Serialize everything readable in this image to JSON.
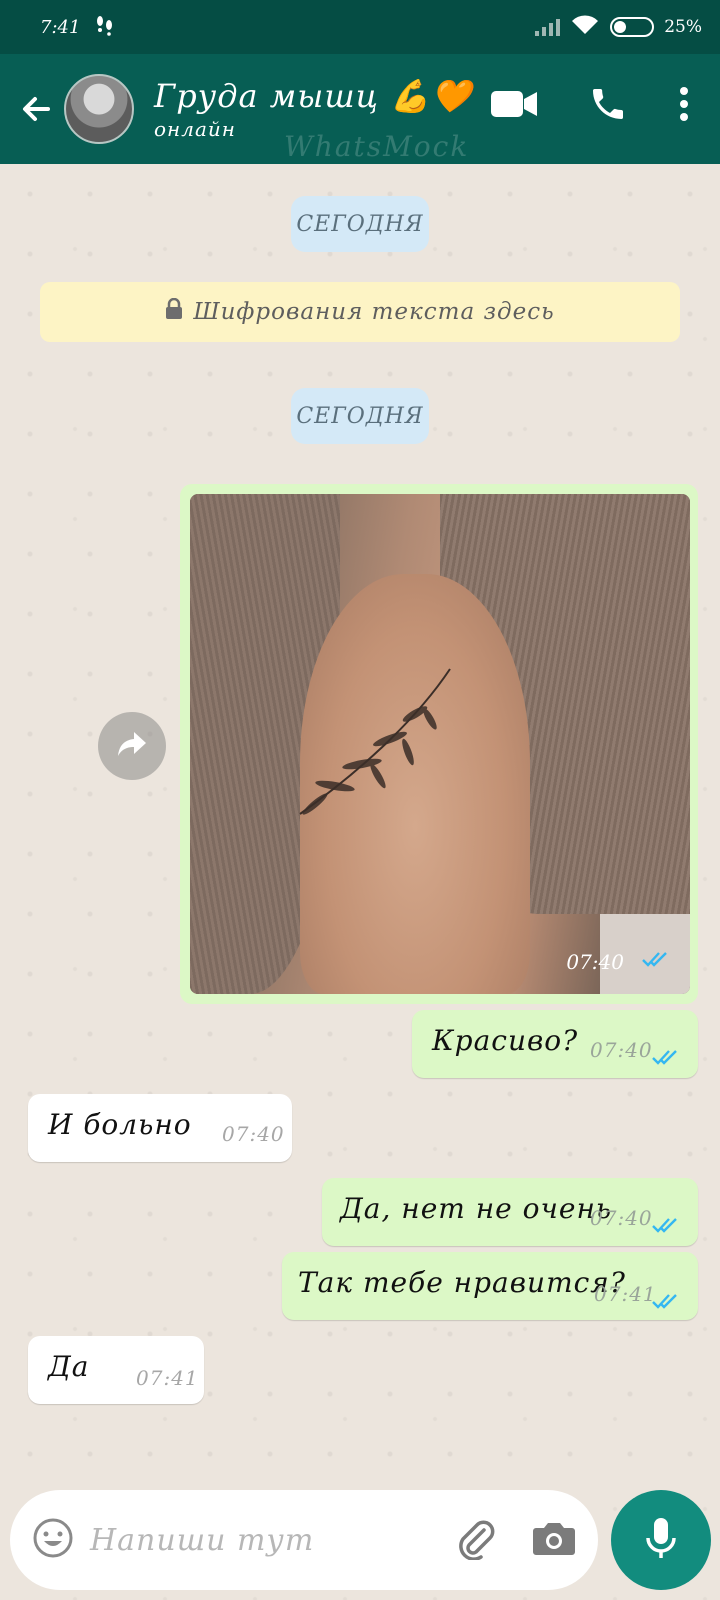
{
  "status_bar": {
    "time": "7:41",
    "battery": "25%"
  },
  "header": {
    "name": "Груда мышц 💪🧡",
    "status": "онлайн",
    "watermark": "WhatsMock"
  },
  "date_chips": [
    "СЕГОДНЯ",
    "СЕГОДНЯ"
  ],
  "encryption_notice": "Шифрования текста здесь",
  "messages": [
    {
      "type": "image",
      "direction": "out",
      "time": "07:40"
    },
    {
      "direction": "out",
      "text": "Красиво?",
      "time": "07:40"
    },
    {
      "direction": "in",
      "text": "И больно",
      "time": "07:40"
    },
    {
      "direction": "out",
      "text": "Да, нет не очень",
      "time": "07:40"
    },
    {
      "direction": "out",
      "text": "Так тебе нравится?",
      "time": "07:41"
    },
    {
      "direction": "in",
      "text": "Да",
      "time": "07:41"
    }
  ],
  "composer": {
    "placeholder": "Напиши тут"
  },
  "colors": {
    "header": "#075e54",
    "status_bar": "#054d44",
    "outgoing": "#dcf8c6",
    "incoming": "#ffffff",
    "read_ticks": "#34b7f1",
    "mic": "#128c7e"
  },
  "icons": [
    "back-arrow-icon",
    "video-call-icon",
    "phone-icon",
    "more-vert-icon",
    "lock-icon",
    "forward-icon",
    "emoji-icon",
    "attach-icon",
    "camera-icon",
    "mic-icon"
  ]
}
